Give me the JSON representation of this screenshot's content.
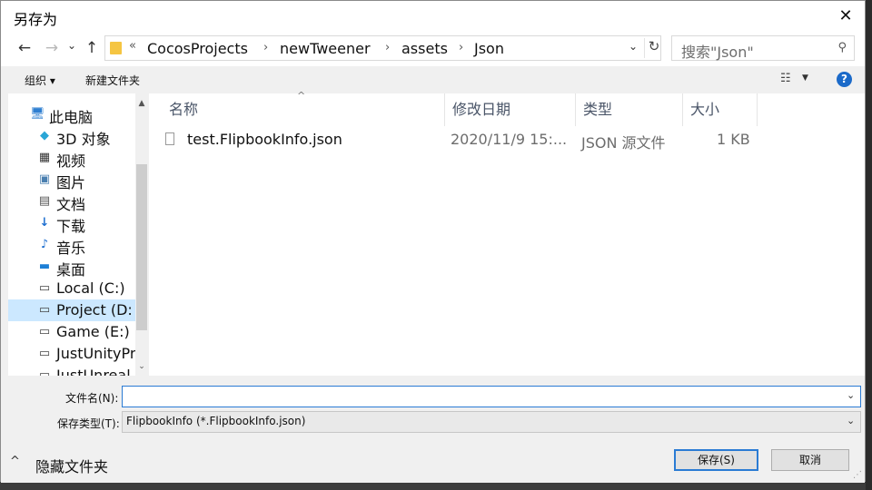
{
  "window": {
    "title": "另存为",
    "close_glyph": "✕"
  },
  "nav": {
    "back_glyph": "←",
    "forward_glyph": "→",
    "history_glyph": "⌄",
    "up_glyph": "↑",
    "breadcrumb_prefix": "«",
    "breadcrumbs": [
      "CocosProjects",
      "newTweener",
      "assets",
      "Json"
    ],
    "separator": "›",
    "dropdown_glyph": "⌄",
    "refresh_glyph": "↻",
    "search_placeholder": "搜索\"Json\"",
    "search_glyph": "⚲"
  },
  "toolbar": {
    "organize_label": "组织 ▾",
    "new_folder_label": "新建文件夹",
    "view_glyph": "☷",
    "view_drop_glyph": "▼",
    "help_glyph": "?"
  },
  "sidebar": {
    "items": [
      {
        "label": "此电脑",
        "icon": "computer-icon",
        "glyph": "🖥"
      },
      {
        "label": "3D 对象",
        "icon": "3d-objects-icon",
        "glyph": "◆"
      },
      {
        "label": "视频",
        "icon": "video-icon",
        "glyph": "▦"
      },
      {
        "label": "图片",
        "icon": "pictures-icon",
        "glyph": "▣"
      },
      {
        "label": "文档",
        "icon": "documents-icon",
        "glyph": "▤"
      },
      {
        "label": "下载",
        "icon": "download-icon",
        "glyph": "↓"
      },
      {
        "label": "音乐",
        "icon": "music-icon",
        "glyph": "♪"
      },
      {
        "label": "桌面",
        "icon": "desktop-icon",
        "glyph": "▬"
      },
      {
        "label": "Local (C:)",
        "icon": "drive-c-icon",
        "glyph": "▭"
      },
      {
        "label": "Project (D:",
        "icon": "drive-d-icon",
        "glyph": "▭",
        "selected": true
      },
      {
        "label": "Game (E:)",
        "icon": "drive-e-icon",
        "glyph": "▭"
      },
      {
        "label": "JustUnityPr",
        "icon": "drive-icon",
        "glyph": "▭"
      },
      {
        "label": "JustUnreal",
        "icon": "drive-icon",
        "glyph": "▭"
      }
    ],
    "scroll_up_glyph": "▲",
    "scroll_down_glyph": "⌄"
  },
  "file_list": {
    "sort_glyph": "^",
    "columns": [
      "名称",
      "修改日期",
      "类型",
      "大小"
    ],
    "rows": [
      {
        "name": "test.FlipbookInfo.json",
        "date": "2020/11/9 15:...",
        "type": "JSON 源文件",
        "size": "1 KB"
      }
    ]
  },
  "bottom": {
    "filename_label": "文件名(N):",
    "filename_value": "",
    "filetype_label": "保存类型(T):",
    "filetype_value": "FlipbookInfo (*.FlipbookInfo.json)",
    "dropdown_glyph": "⌄",
    "hide_folders_glyph": "^",
    "hide_folders_label": "隐藏文件夹",
    "save_label": "保存(S)",
    "cancel_label": "取消",
    "grip_glyph": "⋰"
  },
  "colors": {
    "accent": "#2a7bd4",
    "selected_bg": "#cce8ff",
    "folder": "#f5c542",
    "help": "#1b6ac9"
  }
}
